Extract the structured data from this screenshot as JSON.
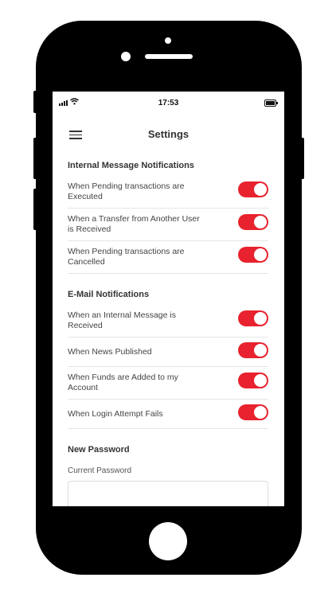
{
  "status_bar": {
    "time": "17:53"
  },
  "header": {
    "title": "Settings"
  },
  "sections": [
    {
      "title": "Internal Message Notifications",
      "items": [
        {
          "label": "When Pending transactions are Executed",
          "enabled": true
        },
        {
          "label": "When a Transfer from Another User is Received",
          "enabled": true
        },
        {
          "label": "When Pending transactions are Cancelled",
          "enabled": true
        }
      ]
    },
    {
      "title": "E-Mail Notifications",
      "items": [
        {
          "label": "When an Internal Message is Received",
          "enabled": true
        },
        {
          "label": "When News Published",
          "enabled": true
        },
        {
          "label": "When Funds are Added to my Account",
          "enabled": true
        },
        {
          "label": "When Login Attempt Fails",
          "enabled": true
        }
      ]
    }
  ],
  "password": {
    "title": "New Password",
    "current_label": "Current Password",
    "current_value": ""
  },
  "colors": {
    "toggle_on": "#e8222e"
  }
}
